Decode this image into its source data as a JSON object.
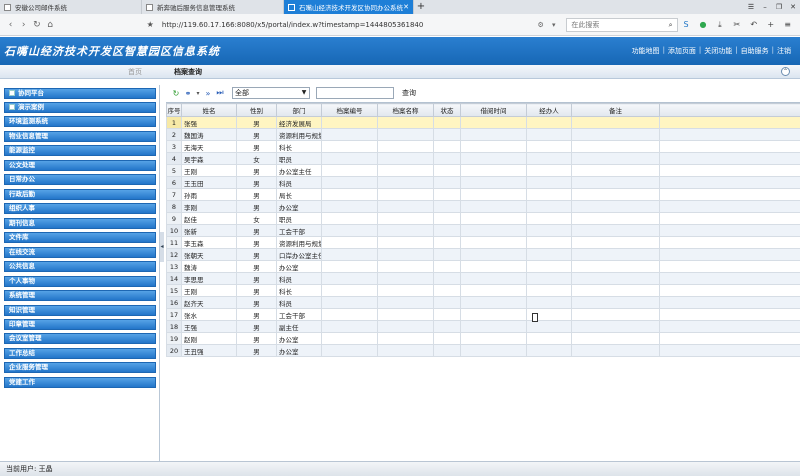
{
  "browser": {
    "tabs": [
      {
        "title": "安徽公司邮件系统",
        "active": false
      },
      {
        "title": "新奔驰后服务信息管理系统",
        "active": false
      },
      {
        "title": "石嘴山经济技术开发区协同办公系统",
        "active": true
      }
    ],
    "new_tab": "+",
    "url": "http://119.60.17.166:8080/x5/portal/index.w?timestamp=1444805361840",
    "search_placeholder": "在此搜索"
  },
  "app": {
    "title": "石嘴山经济技术开发区智慧园区信息系统",
    "header_links": [
      "功能地图",
      "添加页面",
      "关闭功能",
      "自助服务",
      "注销"
    ]
  },
  "module_tabs": {
    "home": "首页",
    "current": "档案查询"
  },
  "sidebar": {
    "items": [
      "协同平台",
      "演示案例",
      "环境监测系统",
      "物业信息管理",
      "能源监控",
      "公文处理",
      "日常办公",
      "行政后勤",
      "组织人事",
      "期刊信息",
      "文件库",
      "在线交流",
      "公共信息",
      "个人事物",
      "系统管理",
      "知识管理",
      "印章管理",
      "会议室管理",
      "工作总结",
      "企业服务管理",
      "党建工作"
    ]
  },
  "toolbar": {
    "filter_value": "全部",
    "query_label": "查询"
  },
  "grid": {
    "columns": [
      "序号",
      "姓名",
      "性别",
      "部门",
      "档案编号",
      "档案名称",
      "状态",
      "借阅时间",
      "经办人",
      "备注"
    ],
    "rows": [
      [
        "1",
        "张强",
        "男",
        "经济发展局"
      ],
      [
        "2",
        "魏国涛",
        "男",
        "资源利用与规划"
      ],
      [
        "3",
        "无海天",
        "男",
        "科长"
      ],
      [
        "4",
        "吴宇森",
        "女",
        "职员"
      ],
      [
        "5",
        "王刚",
        "男",
        "办公室主任"
      ],
      [
        "6",
        "王玉田",
        "男",
        "科员"
      ],
      [
        "7",
        "孙雨",
        "男",
        "局长"
      ],
      [
        "8",
        "李刚",
        "男",
        "办公室"
      ],
      [
        "9",
        "赵佳",
        "女",
        "职员"
      ],
      [
        "10",
        "张新",
        "男",
        "工会干部"
      ],
      [
        "11",
        "李玉森",
        "男",
        "资源利用与规划"
      ],
      [
        "12",
        "张朝天",
        "男",
        "口岸办公室主任"
      ],
      [
        "13",
        "魏涛",
        "男",
        "办公室"
      ],
      [
        "14",
        "李思思",
        "男",
        "科员"
      ],
      [
        "15",
        "王刚",
        "男",
        "科长"
      ],
      [
        "16",
        "赵齐天",
        "男",
        "科员"
      ],
      [
        "17",
        "张水",
        "男",
        "工会干部"
      ],
      [
        "18",
        "王强",
        "男",
        "副主任"
      ],
      [
        "19",
        "赵刚",
        "男",
        "办公室"
      ],
      [
        "20",
        "王丑强",
        "男",
        "办公室"
      ]
    ],
    "selected_row": 1
  },
  "status": {
    "current_user": "当前用户: 王晶"
  },
  "colors": {
    "header_blue": "#1e74c6",
    "menu_blue": "#2f86d6",
    "selected_row": "#fff5c2"
  }
}
